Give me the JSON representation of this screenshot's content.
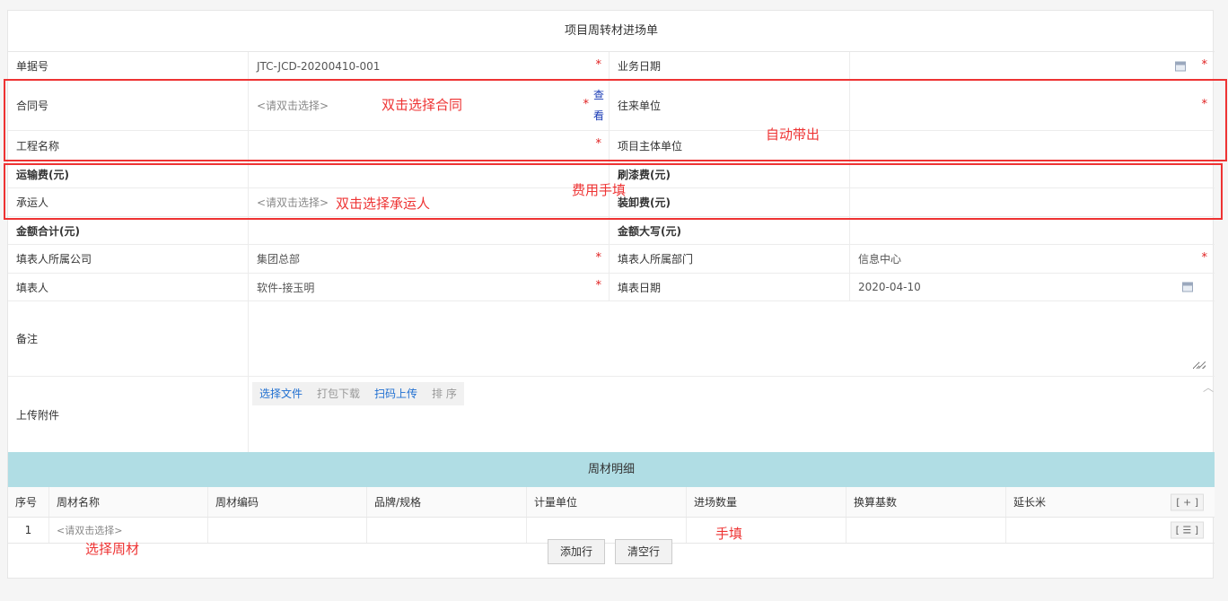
{
  "form_title": "项目周转材进场单",
  "required_mark": "*",
  "fields": {
    "doc_no_label": "单据号",
    "doc_no_value": "JTC-JCD-20200410-001",
    "biz_date_label": "业务日期",
    "contract_label": "合同号",
    "contract_placeholder": "<请双击选择>",
    "view_label": "查看",
    "partner_label": "往来单位",
    "project_label": "工程名称",
    "owner_label": "项目主体单位",
    "transport_label": "运输费(元)",
    "paint_label": "刷漆费(元)",
    "carrier_label": "承运人",
    "carrier_placeholder": "<请双击选择>",
    "loading_label": "装卸费(元)",
    "total_label": "金额合计(元)",
    "total_upper_label": "金额大写(元)",
    "company_label": "填表人所属公司",
    "company_value": "集团总部",
    "dept_label": "填表人所属部门",
    "dept_value": "信息中心",
    "filler_label": "填表人",
    "filler_value": "软件-接玉明",
    "fill_date_label": "填表日期",
    "fill_date_value": "2020-04-10",
    "remark_label": "备注",
    "attach_label": "上传附件"
  },
  "attach_buttons": {
    "select": "选择文件",
    "pack": "打包下载",
    "scan": "扫码上传",
    "sort": "排 序"
  },
  "detail": {
    "title": "周材明细",
    "columns": [
      "序号",
      "周材名称",
      "周材编码",
      "品牌/规格",
      "计量单位",
      "进场数量",
      "换算基数",
      "延长米"
    ],
    "add_col_btn": "[ + ]",
    "rows": [
      {
        "seq": "1",
        "name_placeholder": "<请双击选择>",
        "menu_btn": "[ ☰ ]"
      }
    ],
    "add_row": "添加行",
    "clear_rows": "清空行"
  },
  "annotations": {
    "contract": "双击选择合同",
    "auto": "自动带出",
    "fee": "费用手填",
    "carrier": "双击选择承运人",
    "material": "选择周材",
    "qty": "手填"
  },
  "icons": [
    "calendar-icon",
    "chevron-up-icon",
    "resize-handle-icon"
  ]
}
